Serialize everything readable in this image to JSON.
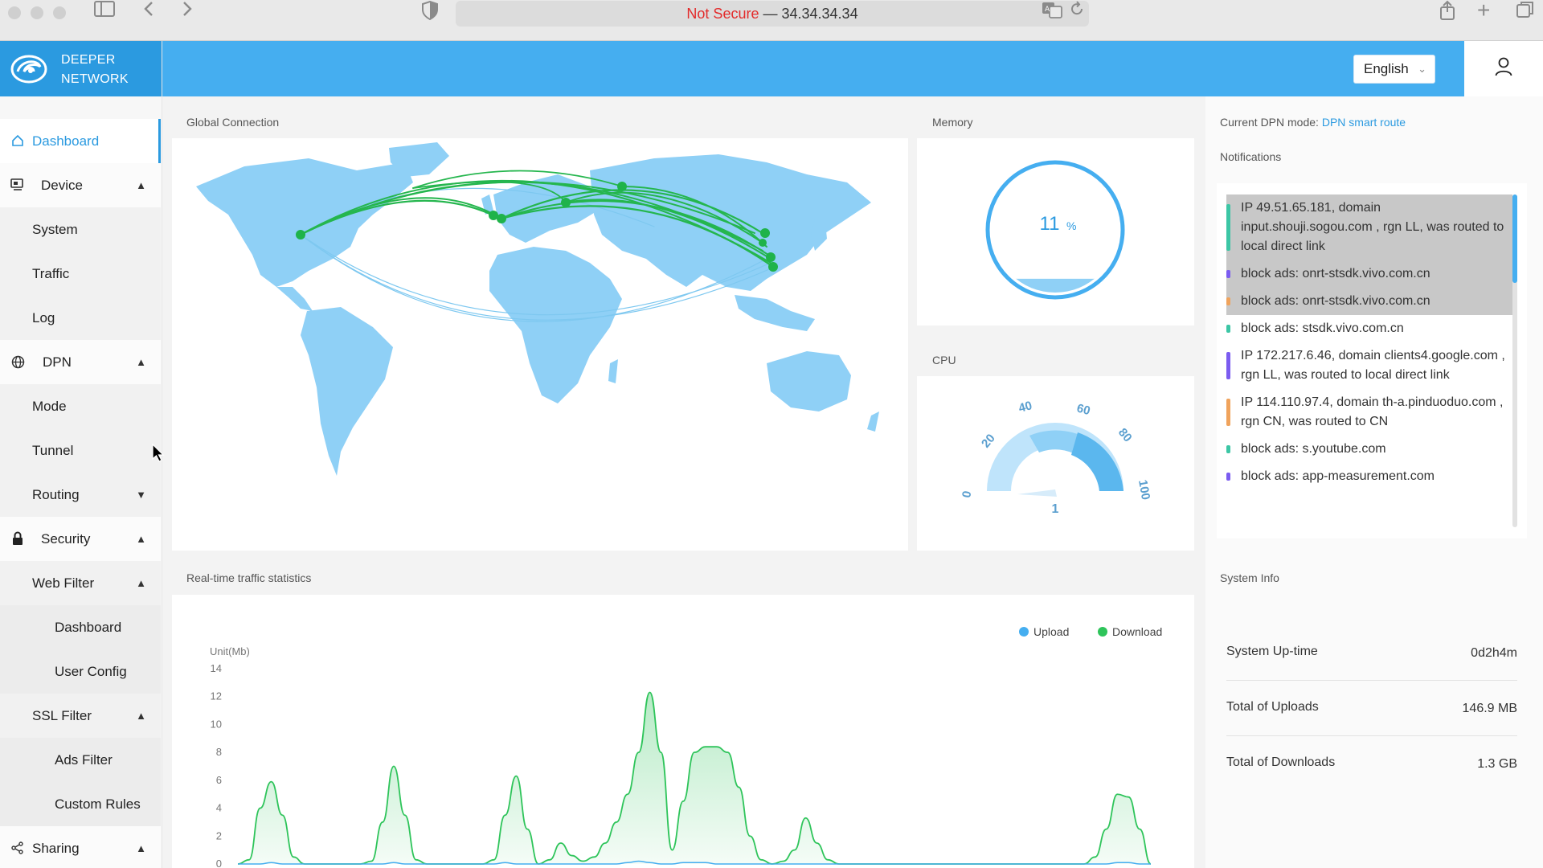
{
  "browser": {
    "address_prefix": "Not Secure",
    "address_separator": " — ",
    "address_host": "34.34.34.34",
    "icons": [
      "sidebar-toggle-icon",
      "back-icon",
      "forward-icon",
      "shield-icon",
      "translate-icon",
      "reload-icon",
      "share-icon",
      "new-tab-icon",
      "tabs-overview-icon"
    ]
  },
  "brand": {
    "line1": "DEEPER",
    "line2": "NETWORK"
  },
  "header": {
    "language": "English"
  },
  "sidebar": {
    "items": [
      {
        "label": "Dashboard",
        "icon": "home-icon"
      },
      {
        "label": "Device",
        "icon": "device-icon"
      },
      {
        "label": "System"
      },
      {
        "label": "Traffic"
      },
      {
        "label": "Log"
      },
      {
        "label": "DPN",
        "icon": "globe-icon"
      },
      {
        "label": "Mode"
      },
      {
        "label": "Tunnel"
      },
      {
        "label": "Routing"
      },
      {
        "label": "Security",
        "icon": "lock-icon"
      },
      {
        "label": "Web Filter"
      },
      {
        "label": "Dashboard"
      },
      {
        "label": "User Config"
      },
      {
        "label": "SSL Filter"
      },
      {
        "label": "Ads Filter"
      },
      {
        "label": "Custom Rules"
      },
      {
        "label": "Sharing",
        "icon": "share-icon"
      }
    ]
  },
  "global_connection": {
    "title": "Global Connection"
  },
  "memory": {
    "title": "Memory",
    "value": "11",
    "unit": "%",
    "fraction": 0.11
  },
  "cpu": {
    "title": "CPU",
    "value": "1",
    "ticks": [
      "0",
      "20",
      "40",
      "60",
      "80",
      "100"
    ]
  },
  "dpn": {
    "label": "Current DPN mode: ",
    "value": "DPN smart route"
  },
  "notifications": {
    "title": "Notifications",
    "items": [
      {
        "text": "IP 49.51.65.181, domain input.shouji.sogou.com , rgn LL, was routed to local direct link",
        "color": "#3cc6a5",
        "highlight": true
      },
      {
        "text": "block ads: onrt-stsdk.vivo.com.cn",
        "color": "#7b5cf0",
        "highlight": true
      },
      {
        "text": "block ads: onrt-stsdk.vivo.com.cn",
        "color": "#f0a35c",
        "highlight": true
      },
      {
        "text": "block ads: stsdk.vivo.com.cn",
        "color": "#3cc6a5",
        "highlight": false
      },
      {
        "text": "IP 172.217.6.46, domain clients4.google.com , rgn LL, was routed to local direct link",
        "color": "#7b5cf0",
        "highlight": false
      },
      {
        "text": "IP 114.110.97.4, domain th-a.pinduoduo.com , rgn CN, was routed to CN",
        "color": "#f0a35c",
        "highlight": false
      },
      {
        "text": "block ads: s.youtube.com",
        "color": "#3cc6a5",
        "highlight": false
      },
      {
        "text": "block ads: app-measurement.com",
        "color": "#7b5cf0",
        "highlight": false
      }
    ]
  },
  "traffic": {
    "title": "Real-time traffic statistics",
    "unit_label": "Unit(Mb)",
    "legend_upload": "Upload",
    "legend_download": "Download"
  },
  "system_info": {
    "title": "System Info",
    "rows": [
      {
        "label": "System Up-time",
        "value": "0d2h4m"
      },
      {
        "label": "Total of Uploads",
        "value": "146.9 MB"
      },
      {
        "label": "Total of Downloads",
        "value": "1.3 GB"
      }
    ]
  },
  "colors": {
    "accent": "#45aef0",
    "download": "#2ec45a",
    "upload": "#45aef0"
  },
  "chart_data": {
    "type": "area",
    "ylabel": "Unit(Mb)",
    "ylim": [
      0,
      14
    ],
    "yticks": [
      0,
      2,
      4,
      6,
      8,
      10,
      12,
      14
    ],
    "series": [
      {
        "name": "Download",
        "color": "#2ec45a",
        "values": [
          0,
          0.3,
          4.0,
          5.9,
          3.5,
          0.5,
          0,
          0,
          0,
          0,
          0,
          0,
          0.2,
          3.0,
          7.0,
          3.5,
          0.3,
          0,
          0,
          0,
          0,
          0,
          0,
          0.3,
          3.5,
          6.3,
          2.5,
          0,
          0.3,
          1.5,
          0.6,
          0.2,
          0.5,
          1.5,
          3.0,
          5.0,
          8.0,
          12.3,
          8.0,
          1.0,
          4.5,
          8.0,
          8.4,
          8.4,
          8.0,
          5.5,
          2.0,
          0.3,
          0,
          0.2,
          1.0,
          3.3,
          1.5,
          0.3,
          0,
          0,
          0,
          0,
          0,
          0,
          0,
          0,
          0,
          0,
          0,
          0,
          0,
          0,
          0,
          0,
          0,
          0,
          0,
          0,
          0,
          0,
          0,
          0.5,
          2.5,
          5.0,
          4.8,
          2.5,
          0
        ]
      },
      {
        "name": "Upload",
        "color": "#45aef0",
        "values": [
          0,
          0,
          0,
          0.1,
          0,
          0,
          0,
          0,
          0,
          0,
          0,
          0,
          0,
          0,
          0.1,
          0,
          0,
          0,
          0,
          0,
          0,
          0,
          0,
          0,
          0.1,
          0,
          0,
          0,
          0,
          0,
          0,
          0,
          0,
          0,
          0,
          0.1,
          0.2,
          0.1,
          0,
          0,
          0.1,
          0.1,
          0.1,
          0,
          0,
          0,
          0,
          0,
          0,
          0,
          0,
          0,
          0,
          0,
          0,
          0,
          0,
          0,
          0,
          0,
          0,
          0,
          0,
          0,
          0,
          0,
          0,
          0,
          0,
          0,
          0,
          0,
          0,
          0,
          0,
          0,
          0,
          0,
          0,
          0.1,
          0.1,
          0,
          0
        ]
      }
    ]
  }
}
